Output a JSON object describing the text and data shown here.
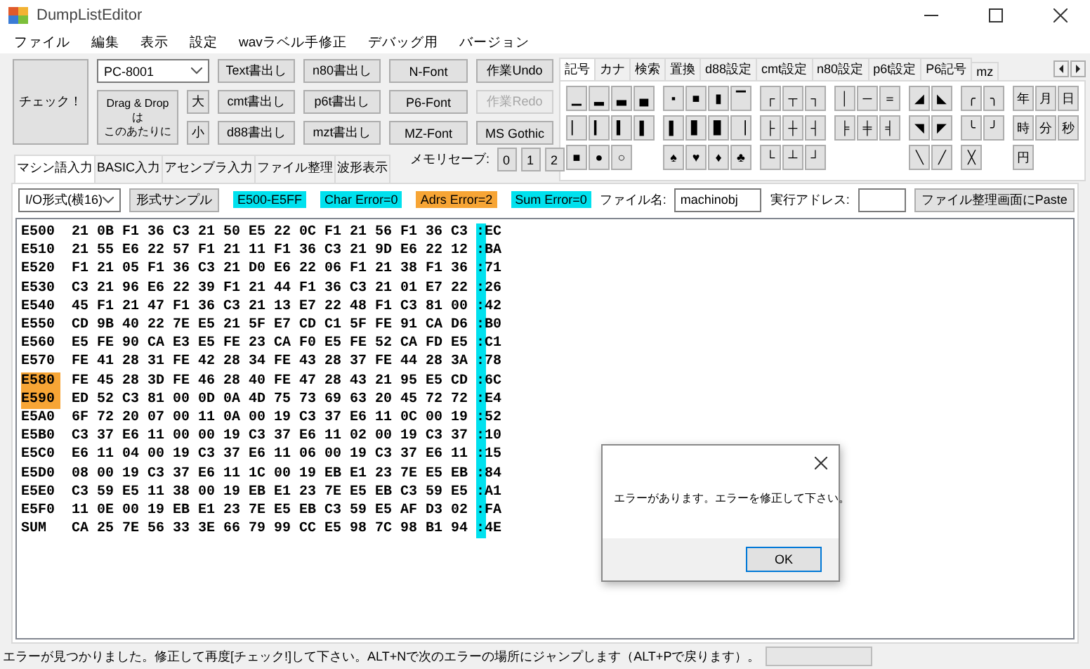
{
  "window": {
    "title": "DumpListEditor"
  },
  "menu": [
    "ファイル",
    "編集",
    "表示",
    "設定",
    "wavラベル手修正",
    "デバッグ用",
    "バージョン"
  ],
  "check_button": "チェック！",
  "machine_select": {
    "value": "PC-8001"
  },
  "drop_area": {
    "lines": [
      "Drag & Drop",
      "は",
      "このあたりに"
    ]
  },
  "size_buttons": [
    "大",
    "小"
  ],
  "button_columns": [
    [
      {
        "label": "Text書出し",
        "disabled": false
      },
      {
        "label": "cmt書出し",
        "disabled": false
      },
      {
        "label": "d88書出し",
        "disabled": false
      }
    ],
    [
      {
        "label": "n80書出し",
        "disabled": false
      },
      {
        "label": "p6t書出し",
        "disabled": false
      },
      {
        "label": "mzt書出し",
        "disabled": false
      }
    ],
    [
      {
        "label": "N-Font",
        "disabled": false
      },
      {
        "label": "P6-Font",
        "disabled": false
      },
      {
        "label": "MZ-Font",
        "disabled": false
      }
    ],
    [
      {
        "label": "作業Undo",
        "disabled": false
      },
      {
        "label": "作業Redo",
        "disabled": true
      },
      {
        "label": "MS Gothic",
        "disabled": false
      }
    ]
  ],
  "memory_save": {
    "label": "メモリセーブ:",
    "buttons": [
      "0",
      "1",
      "2"
    ]
  },
  "main_tabs": [
    {
      "label": "マシン語入力",
      "selected": true
    },
    {
      "label": "BASIC入力",
      "selected": false
    },
    {
      "label": "アセンブラ入力",
      "selected": false
    },
    {
      "label": "ファイル整理",
      "selected": false
    },
    {
      "label": "波形表示",
      "selected": false
    }
  ],
  "symbol_panel": {
    "tabs": [
      {
        "label": "記号",
        "selected": true
      },
      {
        "label": "カナ",
        "selected": false
      },
      {
        "label": "検索",
        "selected": false
      },
      {
        "label": "置換",
        "selected": false
      },
      {
        "label": "d88設定",
        "selected": false
      },
      {
        "label": "cmt設定",
        "selected": false
      },
      {
        "label": "n80設定",
        "selected": false
      },
      {
        "label": "p6t設定",
        "selected": false
      },
      {
        "label": "P6記号",
        "selected": false
      },
      {
        "label": "mz",
        "selected": false
      }
    ],
    "rows": [
      [
        {
          "kind": "key",
          "label": "▁"
        },
        {
          "kind": "key",
          "label": "▂"
        },
        {
          "kind": "key",
          "label": "▃"
        },
        {
          "kind": "key",
          "label": "▄"
        },
        {
          "kind": "key",
          "label": "▪"
        },
        {
          "kind": "key",
          "label": "■"
        },
        {
          "kind": "key",
          "label": "▮"
        },
        {
          "kind": "key",
          "label": "▔"
        },
        {
          "kind": "key",
          "label": "┌"
        },
        {
          "kind": "key",
          "label": "┬"
        },
        {
          "kind": "key",
          "label": "┐"
        },
        {
          "kind": "key",
          "label": "│"
        },
        {
          "kind": "key",
          "label": "─"
        },
        {
          "kind": "key",
          "label": "＝"
        },
        {
          "kind": "key",
          "label": "◢"
        },
        {
          "kind": "key",
          "label": "◣"
        },
        {
          "kind": "key",
          "label": "╭"
        },
        {
          "kind": "key",
          "label": "╮"
        },
        {
          "kind": "key",
          "label": "年"
        },
        {
          "kind": "key",
          "label": "月"
        },
        {
          "kind": "key",
          "label": "日"
        }
      ],
      [
        {
          "kind": "key",
          "label": "▏"
        },
        {
          "kind": "key",
          "label": "▎"
        },
        {
          "kind": "key",
          "label": "▍"
        },
        {
          "kind": "key",
          "label": "▌"
        },
        {
          "kind": "key",
          "label": "▌"
        },
        {
          "kind": "key",
          "label": "▋"
        },
        {
          "kind": "key",
          "label": "▊"
        },
        {
          "kind": "key",
          "label": "▕"
        },
        {
          "kind": "key",
          "label": "├"
        },
        {
          "kind": "key",
          "label": "┼"
        },
        {
          "kind": "key",
          "label": "┤"
        },
        {
          "kind": "key",
          "label": "╞"
        },
        {
          "kind": "key",
          "label": "╪"
        },
        {
          "kind": "key",
          "label": "╡"
        },
        {
          "kind": "key",
          "label": "◥"
        },
        {
          "kind": "key",
          "label": "◤"
        },
        {
          "kind": "key",
          "label": "╰"
        },
        {
          "kind": "key",
          "label": "╯"
        },
        {
          "kind": "key",
          "label": "時"
        },
        {
          "kind": "key",
          "label": "分"
        },
        {
          "kind": "key",
          "label": "秒"
        }
      ],
      [
        {
          "kind": "key",
          "label": "■"
        },
        {
          "kind": "key",
          "label": "●"
        },
        {
          "kind": "key",
          "label": "○"
        },
        {
          "kind": "blank"
        },
        {
          "kind": "key",
          "label": "♠"
        },
        {
          "kind": "key",
          "label": "♥"
        },
        {
          "kind": "key",
          "label": "♦"
        },
        {
          "kind": "key",
          "label": "♣"
        },
        {
          "kind": "key",
          "label": "└"
        },
        {
          "kind": "key",
          "label": "┴"
        },
        {
          "kind": "key",
          "label": "┘"
        },
        {
          "kind": "blank"
        },
        {
          "kind": "blank"
        },
        {
          "kind": "blank"
        },
        {
          "kind": "key",
          "label": "╲"
        },
        {
          "kind": "key",
          "label": "╱"
        },
        {
          "kind": "key",
          "label": "╳"
        },
        {
          "kind": "blank"
        },
        {
          "kind": "key",
          "label": "円"
        },
        {
          "kind": "blank"
        },
        {
          "kind": "blank"
        }
      ]
    ]
  },
  "toolbar": {
    "format_select": {
      "value": "I/O形式(横16)"
    },
    "sample_button": "形式サンプル",
    "badges": [
      {
        "text": "E500-E5FF",
        "color": "#00e1ee"
      },
      {
        "text": "Char Error=0",
        "color": "#00e1ee"
      },
      {
        "text": "Adrs Error=2",
        "color": "#f7a535"
      },
      {
        "text": "Sum Error=0",
        "color": "#00e1ee"
      }
    ],
    "file_name": {
      "label": "ファイル名:",
      "value": "machinobj"
    },
    "exec_address": {
      "label": "実行アドレス:"
    },
    "paste_button": "ファイル整理画面にPaste"
  },
  "editor": {
    "rows": [
      {
        "address": "E500",
        "bytes": "21 0B F1 36 C3 21 50 E5 22 0C F1 21 56 F1 36 C3",
        "sum": ":EC",
        "flagged": false
      },
      {
        "address": "E510",
        "bytes": "21 55 E6 22 57 F1 21 11 F1 36 C3 21 9D E6 22 12",
        "sum": ":BA",
        "flagged": false
      },
      {
        "address": "E520",
        "bytes": "F1 21 05 F1 36 C3 21 D0 E6 22 06 F1 21 38 F1 36",
        "sum": ":71",
        "flagged": false
      },
      {
        "address": "E530",
        "bytes": "C3 21 96 E6 22 39 F1 21 44 F1 36 C3 21 01 E7 22",
        "sum": ":26",
        "flagged": false
      },
      {
        "address": "E540",
        "bytes": "45 F1 21 47 F1 36 C3 21 13 E7 22 48 F1 C3 81 00",
        "sum": ":42",
        "flagged": false
      },
      {
        "address": "E550",
        "bytes": "CD 9B 40 22 7E E5 21 5F E7 CD C1 5F FE 91 CA D6",
        "sum": ":B0",
        "flagged": false
      },
      {
        "address": "E560",
        "bytes": "E5 FE 90 CA E3 E5 FE 23 CA F0 E5 FE 52 CA FD E5",
        "sum": ":C1",
        "flagged": false
      },
      {
        "address": "E570",
        "bytes": "FE 41 28 31 FE 42 28 34 FE 43 28 37 FE 44 28 3A",
        "sum": ":78",
        "flagged": false
      },
      {
        "address": "E580",
        "bytes": "FE 45 28 3D FE 46 28 40 FE 47 28 43 21 95 E5 CD",
        "sum": ":6C",
        "flagged": true
      },
      {
        "address": "E590",
        "bytes": "ED 52 C3 81 00 0D 0A 4D 75 73 69 63 20 45 72 72",
        "sum": ":E4",
        "flagged": true
      },
      {
        "address": "E5A0",
        "bytes": "6F 72 20 07 00 11 0A 00 19 C3 37 E6 11 0C 00 19",
        "sum": ":52",
        "flagged": false
      },
      {
        "address": "E5B0",
        "bytes": "C3 37 E6 11 00 00 19 C3 37 E6 11 02 00 19 C3 37",
        "sum": ":10",
        "flagged": false
      },
      {
        "address": "E5C0",
        "bytes": "E6 11 04 00 19 C3 37 E6 11 06 00 19 C3 37 E6 11",
        "sum": ":15",
        "flagged": false
      },
      {
        "address": "E5D0",
        "bytes": "08 00 19 C3 37 E6 11 1C 00 19 EB E1 23 7E E5 EB",
        "sum": ":84",
        "flagged": false
      },
      {
        "address": "E5E0",
        "bytes": "C3 59 E5 11 38 00 19 EB E1 23 7E E5 EB C3 59 E5",
        "sum": ":A1",
        "flagged": false
      },
      {
        "address": "E5F0",
        "bytes": "11 0E 00 19 EB E1 23 7E E5 EB C3 59 E5 AF D3 02",
        "sum": ":FA",
        "flagged": false
      },
      {
        "address": "SUM",
        "bytes": "CA 25 7E 56 33 3E 66 79 99 CC E5 98 7C 98 B1 94",
        "sum": ":4E",
        "flagged": false
      }
    ]
  },
  "dialog": {
    "message": "エラーがあります。エラーを修正して下さい。",
    "button": "OK"
  },
  "status_bar": {
    "text": "エラーが見つかりました。修正して再度[チェック!]して下さい。ALT+Nで次のエラーの場所にジャンプします（ALT+Pで戻ります）。",
    "progress": {
      "level": 0
    }
  }
}
